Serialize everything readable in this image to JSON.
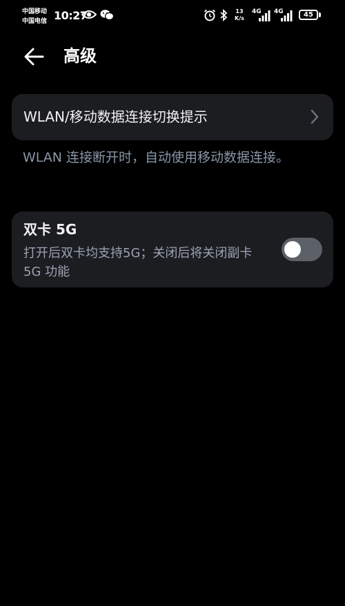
{
  "status_bar": {
    "carrier_1": "中国移动",
    "carrier_2": "中国电信",
    "time": "10:27",
    "speed_value": "13",
    "speed_unit": "K/s",
    "network_1": "4G",
    "network_2": "4G",
    "battery": "45"
  },
  "header": {
    "title": "高级"
  },
  "wlan_switch": {
    "label": "WLAN/移动数据连接切换提示",
    "description": "WLAN 连接断开时，自动使用移动数据连接。"
  },
  "dual_5g": {
    "title": "双卡 5G",
    "subtitle": "打开后双卡均支持5G；关闭后将关闭副卡 5G 功能",
    "enabled": false
  },
  "colors": {
    "background": "#000000",
    "card": "#1c1d21",
    "secondary_text": "#8a96a8",
    "toggle_off": "#5c6168"
  }
}
